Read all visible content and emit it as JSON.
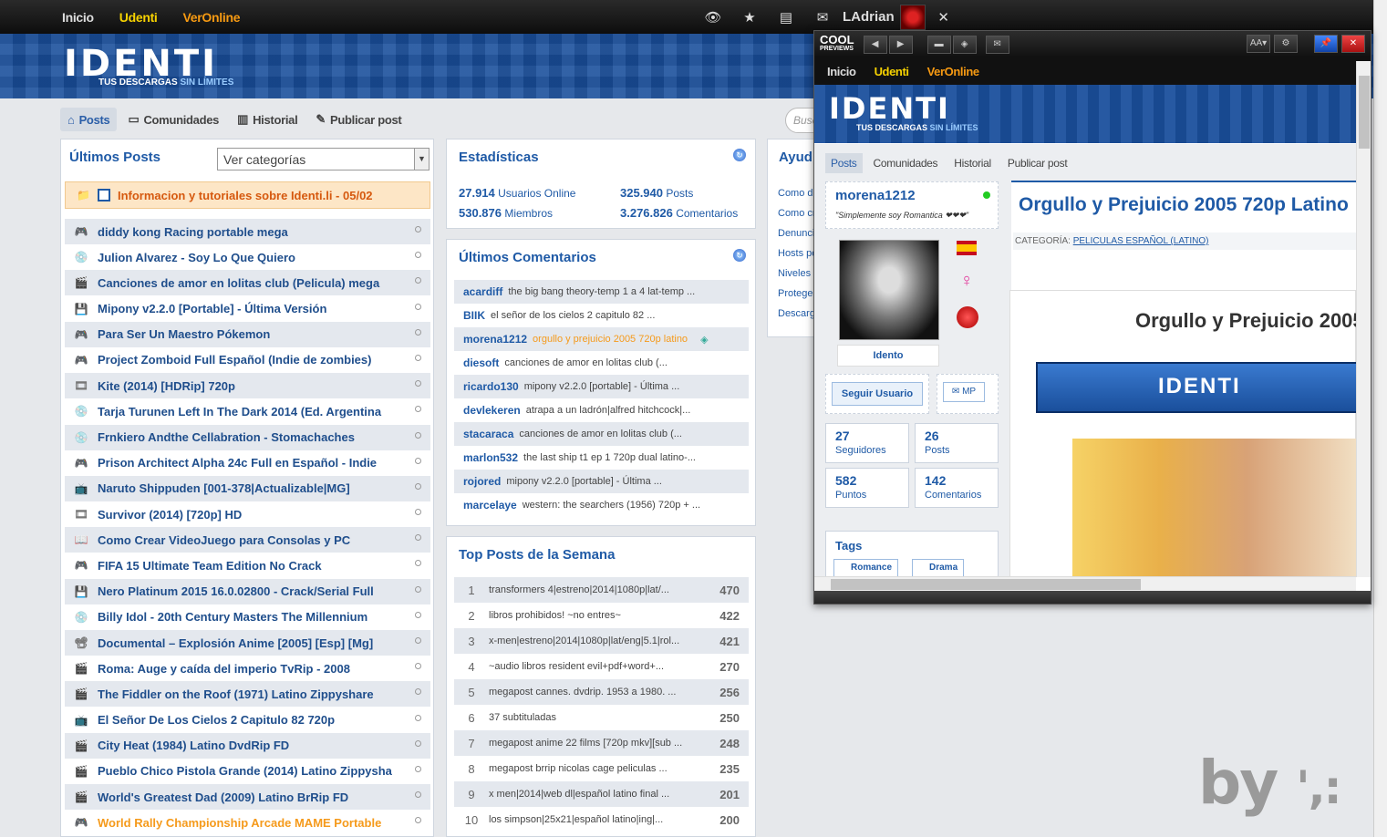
{
  "topbar": {
    "nav": [
      "Inicio",
      "Udenti",
      "VerOnline"
    ],
    "user": "LAdrian",
    "icons": [
      "eye-icon",
      "star-icon",
      "document-icon",
      "mail-icon"
    ],
    "close": "✕"
  },
  "brand": {
    "logo": "IDENTI",
    "tagline": "TUS DESCARGAS",
    "tagline_em": "SIN LÍMITES"
  },
  "subnav": [
    "Posts",
    "Comunidades",
    "Historial",
    "Publicar post"
  ],
  "search_placeholder": "Busc",
  "left": {
    "title": "Últimos Posts",
    "select": "Ver categorías",
    "notice": "Informacion y tutoriales sobre Identi.li - 05/02",
    "posts": [
      "diddy kong Racing portable mega",
      "Julion Alvarez - Soy Lo Que Quiero",
      "Canciones de amor en lolitas club (Pelicula) mega",
      "Mipony v2.2.0 [Portable] - Última Versión",
      "Para Ser Un Maestro Pókemon",
      "Project Zomboid Full Español (Indie de zombies)",
      "Kite (2014) [HDRip] 720p",
      "Tarja Turunen Left In The Dark 2014 (Ed. Argentina",
      "Frnkiero Andthe Cellabration - Stomachaches",
      "Prison Architect Alpha 24c Full en Español - Indie",
      "Naruto Shippuden [001-378|Actualizable|MG]",
      "Survivor (2014) [720p] HD",
      "Como Crear VideoJuego para Consolas y PC",
      "FIFA 15 Ultimate Team Edition No Crack",
      "Nero Platinum 2015 16.0.02800 - Crack/Serial Full",
      "Billy Idol - 20th Century Masters The Millennium",
      "Documental – Explosión Anime [2005] [Esp] [Mg]",
      "Roma: Auge y caída del imperio TvRip - 2008",
      "The Fiddler on the Roof (1971) Latino Zippyshare",
      "El Señor De Los Cielos 2 Capitulo 82 720p",
      "City Heat (1984) Latino DvdRip FD",
      "Pueblo Chico Pistola Grande (2014) Latino Zippysha",
      "World's Greatest Dad (2009) Latino BrRip FD",
      "World Rally Championship Arcade MAME Portable"
    ]
  },
  "stats": {
    "title": "Estadísticas",
    "online_n": "27.914",
    "online_l": "Usuarios Online",
    "posts_n": "325.940",
    "posts_l": "Posts",
    "members_n": "530.876",
    "members_l": "Miembros",
    "comments_n": "3.276.826",
    "comments_l": "Comentarios"
  },
  "comments": {
    "title": "Últimos Comentarios",
    "items": [
      [
        "acardiff",
        "the big bang theory-temp 1 a 4 lat-temp ..."
      ],
      [
        "BIIK",
        "el señor de los cielos 2 capitulo 82 ..."
      ],
      [
        "morena1212",
        "orgullo y prejuicio 2005 720p latino"
      ],
      [
        "diesoft",
        "canciones de amor en lolitas club (..."
      ],
      [
        "ricardo130",
        "mipony v2.2.0 [portable] - Última ..."
      ],
      [
        "devlekeren",
        "atrapa a un ladrón|alfred hitchcock|..."
      ],
      [
        "stacaraca",
        "canciones de amor en lolitas club (..."
      ],
      [
        "marlon532",
        "the last ship t1 ep 1 720p dual latino-..."
      ],
      [
        "rojored",
        "mipony v2.2.0 [portable] - Última ..."
      ],
      [
        "marcelaye",
        "western: the searchers (1956) 720p + ..."
      ]
    ]
  },
  "top": {
    "title": "Top Posts de la Semana",
    "items": [
      [
        "1",
        "transformers 4|estreno|2014|1080p|lat/...",
        "470"
      ],
      [
        "2",
        "libros prohibidos! ~no entres~",
        "422"
      ],
      [
        "3",
        "x-men|estreno|2014|1080p|lat/eng|5.1|rol...",
        "421"
      ],
      [
        "4",
        "~audio libros resident evil+pdf+word+...",
        "270"
      ],
      [
        "5",
        "megapost cannes. dvdrip. 1953 a 1980. ...",
        "256"
      ],
      [
        "6",
        "37 subtituladas",
        "250"
      ],
      [
        "7",
        "megapost anime 22 films [720p mkv][sub ...",
        "248"
      ],
      [
        "8",
        "megapost brrip nicolas cage peliculas ...",
        "235"
      ],
      [
        "9",
        "x men|2014|web dl|español latino final ...",
        "201"
      ],
      [
        "10",
        "los simpson|25x21|español latino|ing|...",
        "200"
      ]
    ]
  },
  "help": {
    "title": "Ayud",
    "links": [
      "Como de",
      "Como cr",
      "Denunci",
      "Hosts pe",
      "Niveles",
      "Protege",
      "Descarg"
    ]
  },
  "watermark": "by",
  "preview": {
    "brand": "COOL",
    "brand_sub": "PREVIEWS",
    "font_btn": "AA▾",
    "nav": [
      "Inicio",
      "Udenti",
      "VerOnline"
    ],
    "logo": "IDENTI",
    "tagline": "TUS DESCARGAS",
    "tagline_em": "SIN LÍMITES",
    "subnav": [
      "Posts",
      "Comunidades",
      "Historial",
      "Publicar post"
    ],
    "user": "morena1212",
    "status": "\"Simplemente soy Romantica ❤❤❤\"",
    "avatar_name": "Idento",
    "follow": "Seguir Usuario",
    "mp": "MP",
    "s1n": "27",
    "s1l": "Seguidores",
    "s2n": "26",
    "s2l": "Posts",
    "s3n": "582",
    "s3l": "Puntos",
    "s4n": "142",
    "s4l": "Comentarios",
    "tags_title": "Tags",
    "tags": [
      "Romance",
      "Drama"
    ],
    "title": "Orgullo y Prejuicio 2005 720p Latino",
    "cat_label": "CATEGORÍA:",
    "cat": "PELICULAS ESPAÑOL (LATINO)",
    "article_title": "Orgullo y Prejuicio 2005",
    "banner": "IDENTI"
  }
}
